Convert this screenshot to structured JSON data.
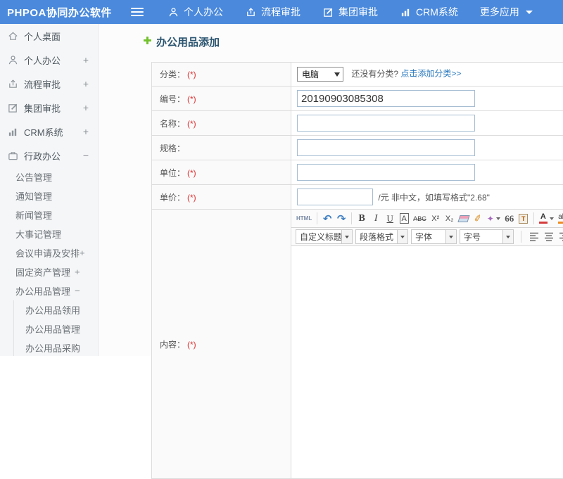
{
  "colors": {
    "accent": "#4a89dc",
    "link": "#2878be",
    "required": "#e03333",
    "title_text": "#2b5570",
    "add_icon_green": "#72c02c"
  },
  "topbar": {
    "brand": "PHPOA协同办公软件",
    "nav": [
      {
        "label": "个人办公",
        "icon": "user-icon"
      },
      {
        "label": "流程审批",
        "icon": "process-icon"
      },
      {
        "label": "集团审批",
        "icon": "approval-edit-icon"
      },
      {
        "label": "CRM系统",
        "icon": "bar-chart-icon"
      },
      {
        "label": "更多应用",
        "icon": "caret-down-icon"
      }
    ]
  },
  "sidebar": {
    "items": [
      {
        "label": "个人桌面",
        "icon": "home-icon",
        "level": 1,
        "expander": ""
      },
      {
        "label": "个人办公",
        "icon": "user-icon",
        "level": 1,
        "expander": "+"
      },
      {
        "label": "流程审批",
        "icon": "process-icon",
        "level": 1,
        "expander": "+"
      },
      {
        "label": "集团审批",
        "icon": "approval-edit-icon",
        "level": 1,
        "expander": "+"
      },
      {
        "label": "CRM系统",
        "icon": "bar-chart-icon",
        "level": 1,
        "expander": "+"
      },
      {
        "label": "行政办公",
        "icon": "briefcase-icon",
        "level": 1,
        "expander": "−"
      },
      {
        "label": "公告管理",
        "level": 2,
        "expander": ""
      },
      {
        "label": "通知管理",
        "level": 2,
        "expander": ""
      },
      {
        "label": "新闻管理",
        "level": 2,
        "expander": ""
      },
      {
        "label": "大事记管理",
        "level": 2,
        "expander": ""
      },
      {
        "label": "会议申请及安排",
        "level": 2,
        "expander": "+"
      },
      {
        "label": "固定资产管理",
        "level": 2,
        "expander": "+"
      },
      {
        "label": "办公用品管理",
        "level": 2,
        "expander": "−"
      },
      {
        "label": "办公用品领用",
        "level": 3,
        "expander": ""
      },
      {
        "label": "办公用品管理",
        "level": 3,
        "expander": ""
      },
      {
        "label": "办公用品采购",
        "level": 3,
        "expander": ""
      }
    ]
  },
  "main": {
    "title": "办公用品添加",
    "form": {
      "rows": [
        {
          "label": "分类：",
          "required": "(*)"
        },
        {
          "label": "编号：",
          "required": "(*)",
          "value": "20190903085308"
        },
        {
          "label": "名称：",
          "required": "(*)",
          "value": ""
        },
        {
          "label": "规格：",
          "required": "",
          "value": ""
        },
        {
          "label": "单位：",
          "required": "(*)",
          "value": ""
        },
        {
          "label": "单价：",
          "required": "(*)",
          "value": "",
          "suffix": "/元 非中文，如填写格式\"2.68\""
        },
        {
          "label": "内容：",
          "required": "(*)"
        }
      ],
      "category": {
        "selected": "电脑",
        "hint": "还没有分类?",
        "link": "点击添加分类>>"
      }
    },
    "editor": {
      "buttons": {
        "html": "HTML",
        "undo": "↶",
        "redo": "↷",
        "bold": "B",
        "italic": "I",
        "underline": "U",
        "border_a": "A",
        "strike": "ABC",
        "sup": "X²",
        "sub": "X₂",
        "quote": "66",
        "font_color": "A",
        "back_color": "ab",
        "brush_glyph": "✐",
        "wand_glyph": "✦",
        "paste_glyph": "T"
      },
      "dropdowns": [
        {
          "label": "自定义标题"
        },
        {
          "label": "段落格式"
        },
        {
          "label": "字体"
        },
        {
          "label": "字号"
        }
      ]
    }
  }
}
